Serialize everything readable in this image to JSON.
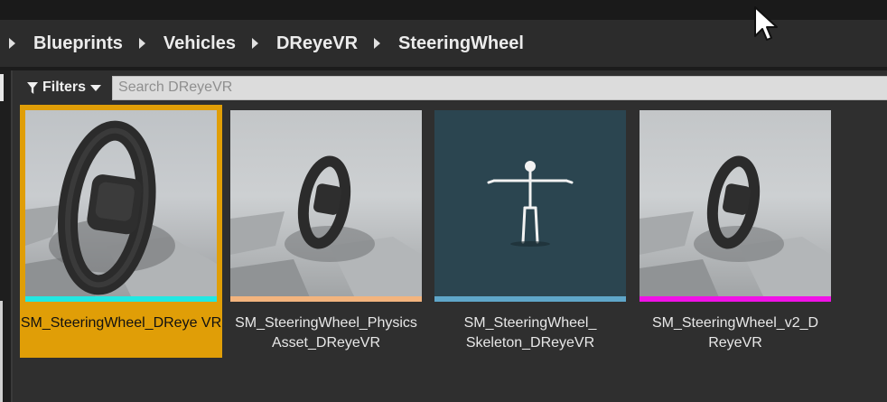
{
  "breadcrumb": [
    {
      "label": "Blueprints"
    },
    {
      "label": "Vehicles"
    },
    {
      "label": "DReyeVR"
    },
    {
      "label": "SteeringWheel"
    }
  ],
  "toolbar": {
    "filters_label": "Filters",
    "search_placeholder": "Search DReyeVR",
    "search_value": ""
  },
  "assets": [
    {
      "name": "SM_SteeringWheel_DReyeVR",
      "display_label": "SM_SteeringWheel_DReye VR",
      "type_color": "#22e8e2",
      "selected": true,
      "thumb": "wheel-large"
    },
    {
      "name": "SM_SteeringWheel_PhysicsAsset_DReyeVR",
      "display_label": "SM_SteeringWheel_Physics Asset_DReyeVR",
      "type_color": "#f3b47e",
      "selected": false,
      "thumb": "wheel-small"
    },
    {
      "name": "SM_SteeringWheel_Skeleton_DReyeVR",
      "display_label": "SM_SteeringWheel_ Skeleton_DReyeVR",
      "type_color": "#5fa6c9",
      "selected": false,
      "thumb": "skeleton"
    },
    {
      "name": "SM_SteeringWheel_v2_DReyeVR",
      "display_label": "SM_SteeringWheel_v2_D ReyeVR",
      "type_color": "#f012e6",
      "selected": false,
      "thumb": "wheel-small"
    }
  ],
  "colors": {
    "selection": "#e09e07",
    "background": "#2f2f2f"
  }
}
